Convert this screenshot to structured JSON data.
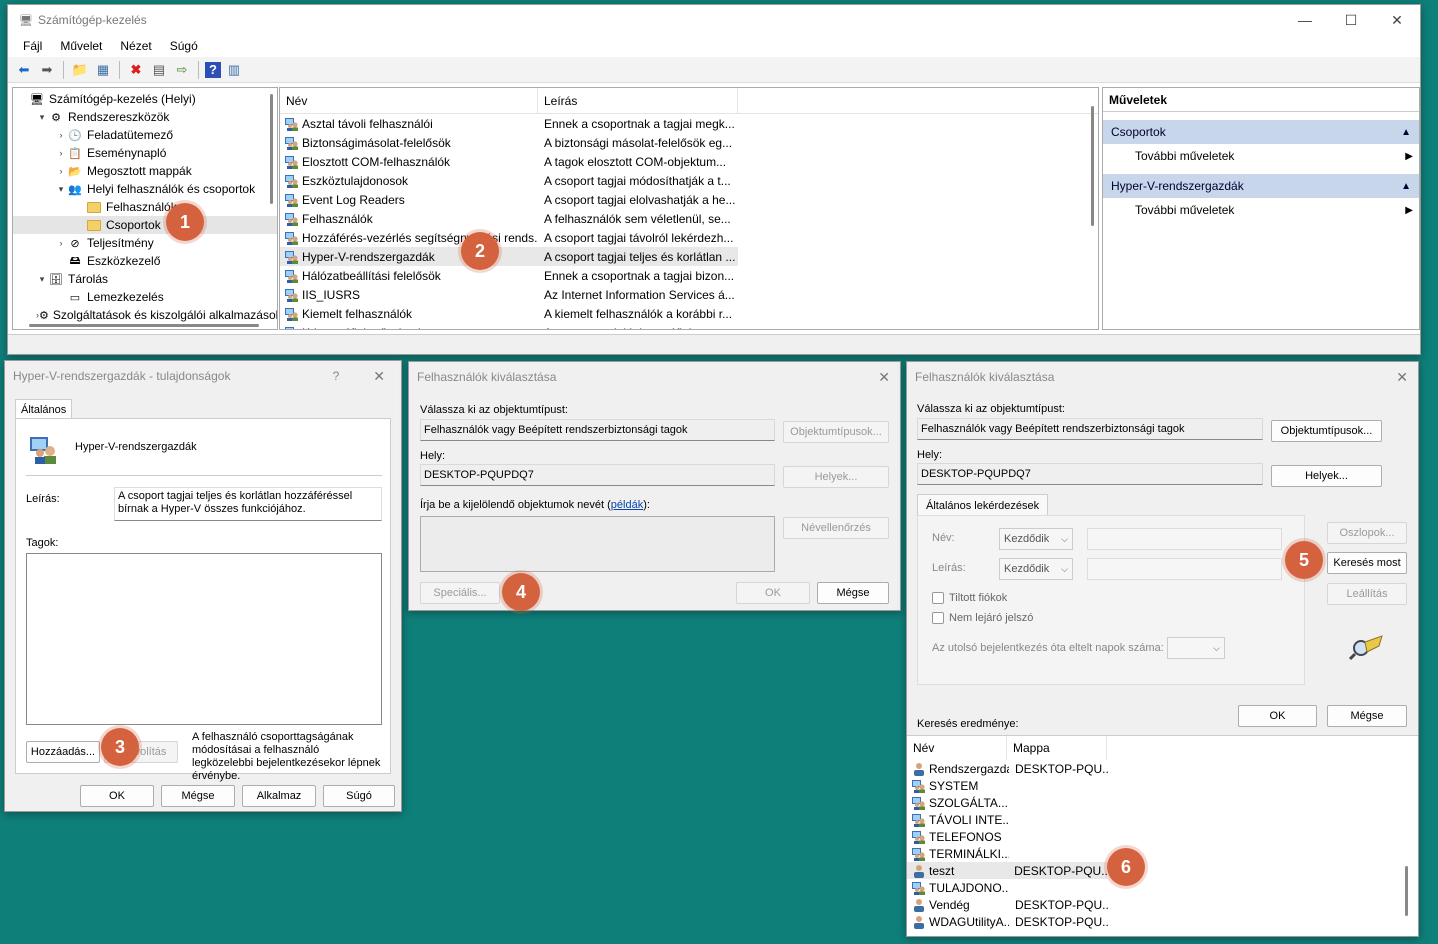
{
  "main_window": {
    "title": "Számítógép-kezelés",
    "menu": [
      "Fájl",
      "Művelet",
      "Nézet",
      "Súgó"
    ],
    "tree": [
      {
        "label": "Számítógép-kezelés (Helyi)",
        "level": 0,
        "expander": ""
      },
      {
        "label": "Rendszereszközök",
        "level": 1,
        "expander": "▾"
      },
      {
        "label": "Feladatütemező",
        "level": 2,
        "expander": "›"
      },
      {
        "label": "Eseménynapló",
        "level": 2,
        "expander": "›"
      },
      {
        "label": "Megosztott mappák",
        "level": 2,
        "expander": "›"
      },
      {
        "label": "Helyi felhasználók és csoportok",
        "level": 2,
        "expander": "▾"
      },
      {
        "label": "Felhasználók",
        "level": 3,
        "expander": ""
      },
      {
        "label": "Csoportok",
        "level": 3,
        "expander": ""
      },
      {
        "label": "Teljesítmény",
        "level": 2,
        "expander": "›"
      },
      {
        "label": "Eszközkezelő",
        "level": 2,
        "expander": ""
      },
      {
        "label": "Tárolás",
        "level": 1,
        "expander": "▾"
      },
      {
        "label": "Lemezkezelés",
        "level": 2,
        "expander": ""
      },
      {
        "label": "Szolgáltatások és kiszolgálói alkalmazások",
        "level": 1,
        "expander": "›"
      }
    ],
    "list_headers": {
      "name": "Név",
      "desc": "Leírás"
    },
    "groups": [
      {
        "name": "Asztal távoli felhasználói",
        "desc": "Ennek a csoportnak a tagjai megk..."
      },
      {
        "name": "Biztonságimásolat-felelősök",
        "desc": "A biztonsági másolat-felelősök eg..."
      },
      {
        "name": "Elosztott COM-felhasználók",
        "desc": "A tagok elosztott COM-objektum..."
      },
      {
        "name": "Eszköztulajdonosok",
        "desc": "A csoport tagjai módosíthatják a t..."
      },
      {
        "name": "Event Log Readers",
        "desc": "A csoport tagjai elolvashatják a he..."
      },
      {
        "name": "Felhasználók",
        "desc": "A felhasználók sem véletlenül, se..."
      },
      {
        "name": "Hozzáférés-vezérlés segítségnyújtási rends...",
        "desc": "A csoport tagjai távolról lekérdezh..."
      },
      {
        "name": "Hyper-V-rendszergazdák",
        "desc": "A csoport tagjai teljes és korlátlan ..."
      },
      {
        "name": "Hálózatbeállítási felelősök",
        "desc": "Ennek a csoportnak a tagjai bizon..."
      },
      {
        "name": "IIS_IUSRS",
        "desc": "Az Internet Information Services á..."
      },
      {
        "name": "Kiemelt felhasználók",
        "desc": "A kiemelt felhasználók a korábbi r..."
      },
      {
        "name": "Kriptográfiai műveletek",
        "desc": "A csoport tagjai kriptográfiai m..."
      }
    ],
    "actions": {
      "header": "Műveletek",
      "group1": "Csoportok",
      "group1_item": "További műveletek",
      "group2": "Hyper-V-rendszergazdák",
      "group2_item": "További műveletek"
    }
  },
  "props_dialog": {
    "title": "Hyper-V-rendszergazdák - tulajdonságok",
    "help": "?",
    "tab": "Általános",
    "group_name": "Hyper-V-rendszergazdák",
    "desc_label": "Leírás:",
    "desc_value": "A csoport tagjai teljes és korlátlan hozzáféréssel bírnak a Hyper-V összes funkciójához.",
    "members_label": "Tagok:",
    "add_btn": "Hozzáadás...",
    "remove_btn": "Eltávolítás",
    "note": "A felhasználó csoporttagságának módosításai a felhasználó legközelebbi bejelentkezésekor lépnek érvénybe.",
    "ok": "OK",
    "cancel": "Mégse",
    "apply": "Alkalmaz",
    "helpbtn": "Súgó"
  },
  "select_small": {
    "title": "Felhasználók kiválasztása",
    "type_label": "Válassza ki az objektumtípust:",
    "type_value": "Felhasználók vagy Beépített rendszerbiztonsági tagok",
    "type_btn": "Objektumtípusok...",
    "loc_label": "Hely:",
    "loc_value": "DESKTOP-PQUPDQ7",
    "loc_btn": "Helyek...",
    "enter_label": "Írja be a kijelölendő objektumok nevét (",
    "examples_link": "példák",
    "enter_label_end": "):",
    "check_btn": "Névellenőrzés",
    "adv_btn": "Speciális...",
    "ok": "OK",
    "cancel": "Mégse"
  },
  "select_large": {
    "title": "Felhasználók kiválasztása",
    "type_label": "Válassza ki az objektumtípust:",
    "type_value": "Felhasználók vagy Beépített rendszerbiztonsági tagok",
    "type_btn": "Objektumtípusok...",
    "loc_label": "Hely:",
    "loc_value": "DESKTOP-PQUPDQ7",
    "loc_btn": "Helyek...",
    "tab": "Általános lekérdezések",
    "name_label": "Név:",
    "desc_label": "Leírás:",
    "starts": "Kezdődik",
    "disabled_chk": "Tiltott fiókok",
    "noexp_chk": "Nem lejáró jelszó",
    "days_label": "Az utolsó bejelentkezés óta eltelt napok száma:",
    "columns_btn": "Oszlopok...",
    "search_btn": "Keresés most",
    "stop_btn": "Leállítás",
    "ok": "OK",
    "cancel": "Mégse",
    "results_label": "Keresés eredménye:",
    "res_headers": {
      "name": "Név",
      "folder": "Mappa"
    },
    "results": [
      {
        "name": "Rendszergazda",
        "folder": "DESKTOP-PQU..."
      },
      {
        "name": "SYSTEM",
        "folder": ""
      },
      {
        "name": "SZOLGÁLTA...",
        "folder": ""
      },
      {
        "name": "TÁVOLI INTE...",
        "folder": ""
      },
      {
        "name": "TELEFONOS",
        "folder": ""
      },
      {
        "name": "TERMINÁLKI...",
        "folder": ""
      },
      {
        "name": "teszt",
        "folder": "DESKTOP-PQU..."
      },
      {
        "name": "TULAJDONO...",
        "folder": ""
      },
      {
        "name": "Vendég",
        "folder": "DESKTOP-PQU..."
      },
      {
        "name": "WDAGUtilityA...",
        "folder": "DESKTOP-PQU..."
      }
    ]
  },
  "badges": [
    "1",
    "2",
    "3",
    "4",
    "5",
    "6"
  ]
}
